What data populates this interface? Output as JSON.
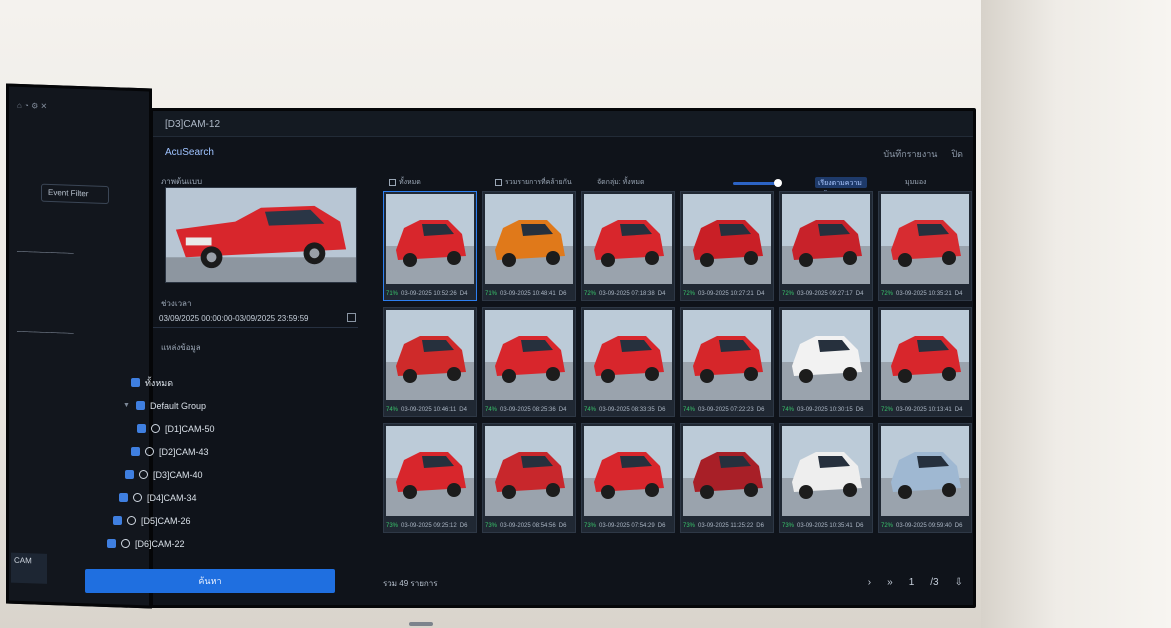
{
  "window": {
    "title": "[D3]CAM-12"
  },
  "app": {
    "name": "AcuSearch"
  },
  "top_actions": {
    "export": "บันทึกรายงาน",
    "close": "ปิด"
  },
  "left": {
    "ref_label": "ภาพต้นแบบ",
    "time_label": "ช่วงเวลา",
    "time_range": "03/09/2025 00:00:00-03/09/2025 23:59:59",
    "cameras_label": "แหล่งข้อมูล",
    "tree": {
      "all": "ทั้งหมด",
      "group": "Default Group",
      "cams": [
        "[D1]CAM-50",
        "[D2]CAM-43",
        "[D3]CAM-40",
        "[D4]CAM-34",
        "[D5]CAM-26",
        "[D6]CAM-22"
      ]
    },
    "search_button": "ค้นหา"
  },
  "filters": {
    "select_all": "ทั้งหมด",
    "merge": "รวมรายการที่คล้ายกัน",
    "group": "จัดกลุ่ม: ทั้งหมด",
    "sort": "เรียงตามความคล้าย",
    "view": "มุมมอง"
  },
  "results": [
    {
      "pct": "71%",
      "time": "03-09-2025 10:52:26",
      "cam": "D4",
      "car": "#d8262c"
    },
    {
      "pct": "71%",
      "time": "03-09-2025 10:48:41",
      "cam": "D6",
      "car": "#e0791a"
    },
    {
      "pct": "72%",
      "time": "03-09-2025 07:18:38",
      "cam": "D4",
      "car": "#d8262c"
    },
    {
      "pct": "72%",
      "time": "03-09-2025 10:27:21",
      "cam": "D4",
      "car": "#c91f26"
    },
    {
      "pct": "72%",
      "time": "03-09-2025 09:27:17",
      "cam": "D4",
      "car": "#c8222a"
    },
    {
      "pct": "72%",
      "time": "03-09-2025 10:35:21",
      "cam": "D4",
      "car": "#d72c31"
    },
    {
      "pct": "74%",
      "time": "03-09-2025 10:46:11",
      "cam": "D4",
      "car": "#cf2a2a"
    },
    {
      "pct": "74%",
      "time": "03-09-2025 08:25:36",
      "cam": "D4",
      "car": "#d8262c"
    },
    {
      "pct": "74%",
      "time": "03-09-2025 08:33:35",
      "cam": "D6",
      "car": "#d8262c"
    },
    {
      "pct": "74%",
      "time": "03-09-2025 07:22:23",
      "cam": "D6",
      "car": "#d6262a"
    },
    {
      "pct": "74%",
      "time": "03-09-2025 10:30:15",
      "cam": "D6",
      "car": "#f2f2f2"
    },
    {
      "pct": "72%",
      "time": "03-09-2025 10:13:41",
      "cam": "D4",
      "car": "#d8262c"
    },
    {
      "pct": "73%",
      "time": "03-09-2025 09:25:12",
      "cam": "D6",
      "car": "#d8262c"
    },
    {
      "pct": "73%",
      "time": "03-09-2025 08:54:56",
      "cam": "D6",
      "car": "#c8272c"
    },
    {
      "pct": "73%",
      "time": "03-09-2025 07:54:29",
      "cam": "D6",
      "car": "#d8262c"
    },
    {
      "pct": "73%",
      "time": "03-09-2025 11:25:22",
      "cam": "D6",
      "car": "#a81f27"
    },
    {
      "pct": "73%",
      "time": "03-09-2025 10:35:41",
      "cam": "D6",
      "car": "#eeeeee"
    },
    {
      "pct": "72%",
      "time": "03-09-2025 09:59:40",
      "cam": "D6",
      "car": "#9fb8d2"
    }
  ],
  "footer": {
    "total": "รวม 49 รายการ",
    "page": "1",
    "pages": "/3"
  },
  "side_monitor": {
    "filter_btn": "Event Filter",
    "cam": "CAM"
  }
}
